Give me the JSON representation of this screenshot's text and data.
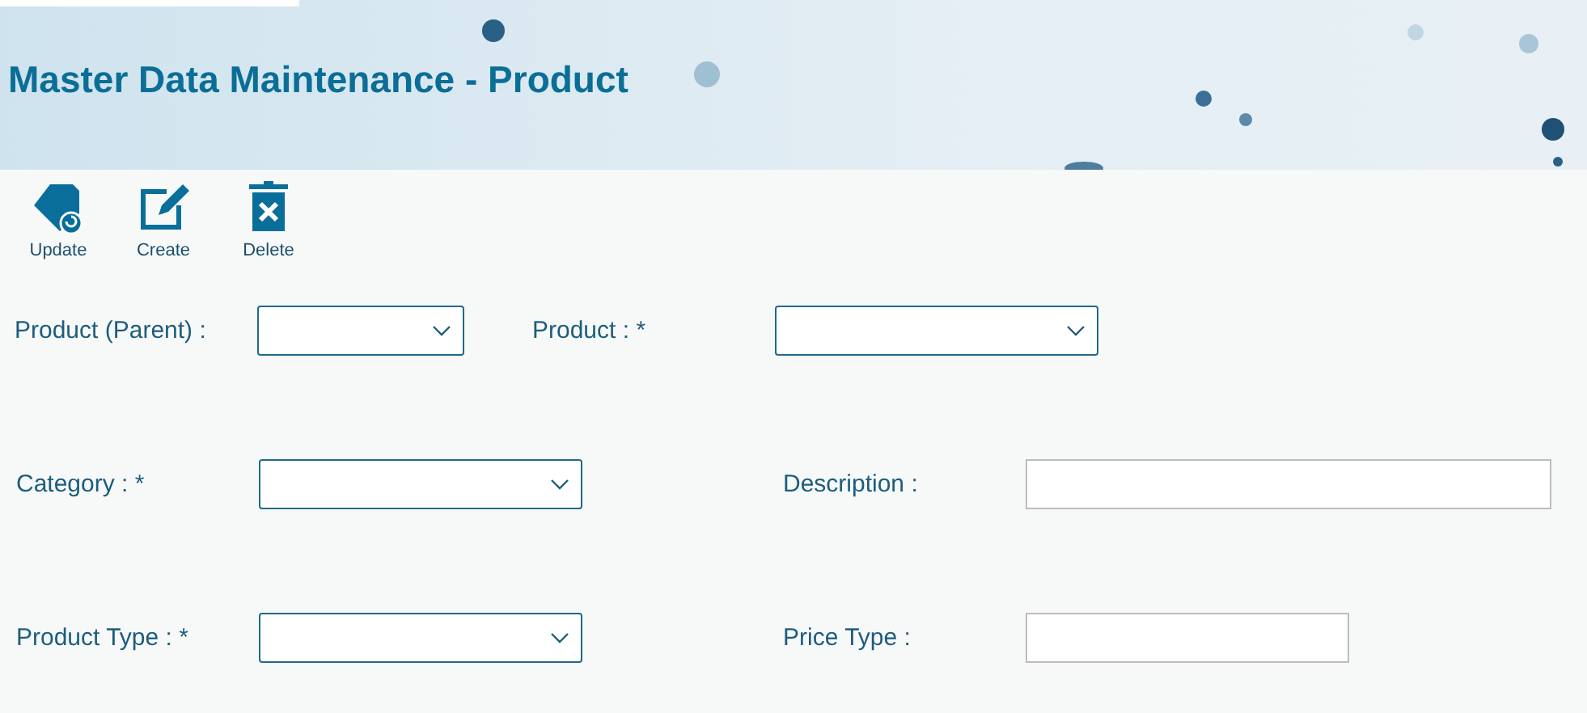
{
  "header": {
    "title": "Master Data Maintenance - Product"
  },
  "toolbar": [
    {
      "label": "Update",
      "kind": "tag"
    },
    {
      "label": "Create",
      "kind": "edit"
    },
    {
      "label": "Delete",
      "kind": "delete"
    }
  ],
  "form_rows": [
    [
      {
        "label": "Product (Parent) :",
        "kind": "dropdown"
      },
      {
        "label": "Product : *",
        "kind": "dropdown"
      }
    ],
    [
      {
        "label": "Category : *",
        "kind": "dropdown"
      },
      {
        "label": "Description :",
        "kind": "text"
      }
    ],
    [
      {
        "label": "Product Type : *",
        "kind": "dropdown"
      },
      {
        "label": "Price Type :",
        "kind": "text"
      }
    ]
  ]
}
